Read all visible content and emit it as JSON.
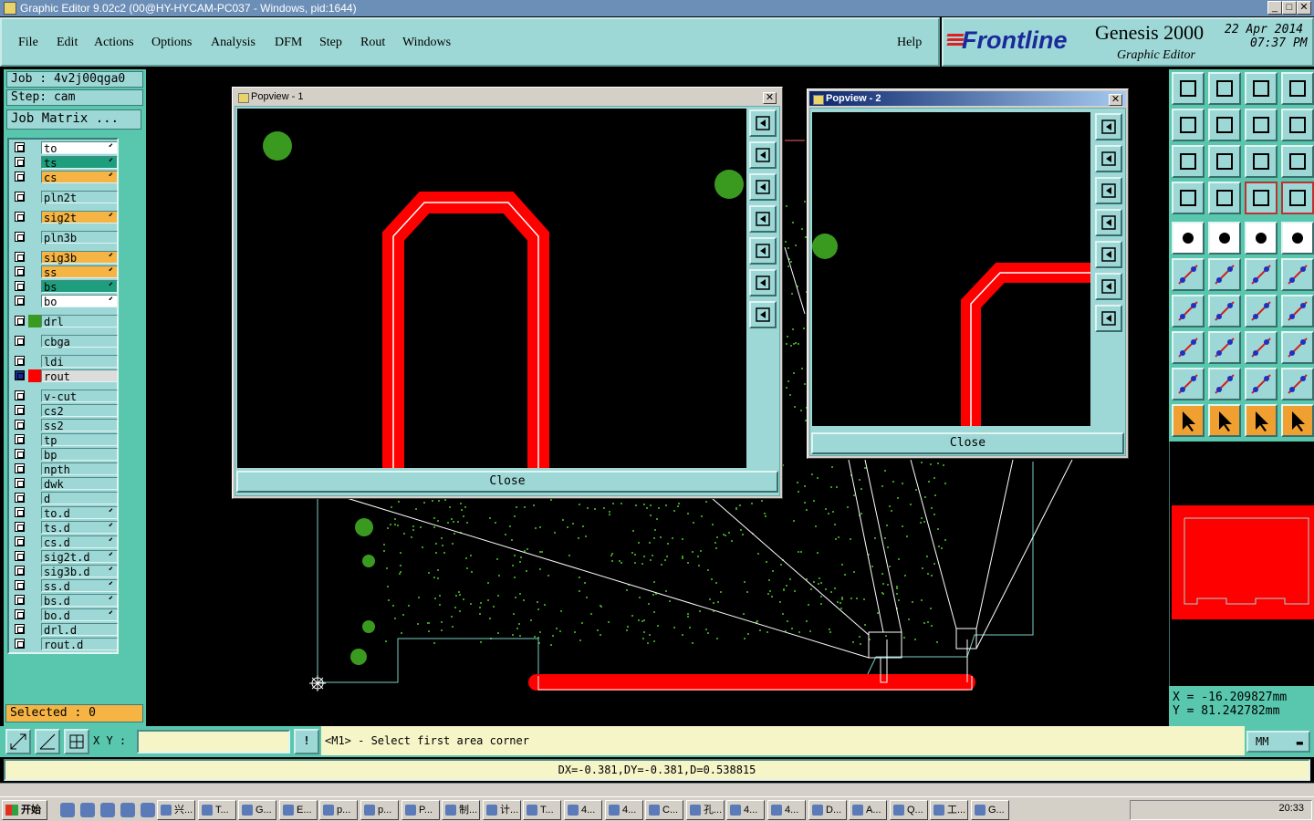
{
  "window": {
    "title": "Graphic Editor 9.02c2 (00@HY-HYCAM-PC037 - Windows, pid:1644)"
  },
  "menu": [
    "File",
    "Edit",
    "Actions",
    "Options",
    "Analysis",
    "DFM",
    "Step",
    "Rout",
    "Windows"
  ],
  "help_label": "Help",
  "logo": {
    "brand": "Frontline",
    "product": "Genesis 2000",
    "subtitle": "Graphic Editor",
    "date": "22 Apr 2014",
    "time": "07:37 PM"
  },
  "job": {
    "job_label": "Job : 4v2j00qga0",
    "step_label": "Step: cam",
    "matrix_label": "Job Matrix ..."
  },
  "layers": [
    {
      "name": "to",
      "color": "#ffffff",
      "arrow": true
    },
    {
      "name": "ts",
      "color": "#1f9e7e",
      "arrow": true
    },
    {
      "name": "cs",
      "color": "#f5b443",
      "arrow": true
    },
    {
      "name": "pln2t",
      "color": "",
      "arrow": false
    },
    {
      "name": "sig2t",
      "color": "#f5b443",
      "arrow": true
    },
    {
      "name": "pln3b",
      "color": "",
      "arrow": false
    },
    {
      "name": "sig3b",
      "color": "#f5b443",
      "arrow": true
    },
    {
      "name": "ss",
      "color": "#f5b443",
      "arrow": true
    },
    {
      "name": "bs",
      "color": "#1f9e7e",
      "arrow": true
    },
    {
      "name": "bo",
      "color": "#ffffff",
      "arrow": true
    },
    {
      "name": "drl",
      "color": "",
      "arrow": false,
      "swatch": "#3a9a20"
    },
    {
      "name": "cbga",
      "color": "",
      "arrow": false
    },
    {
      "name": "ldi",
      "color": "",
      "arrow": false
    },
    {
      "name": "rout",
      "color": "#dcdcdc",
      "arrow": false,
      "swatch": "#ff0000",
      "active": true
    },
    {
      "name": "v-cut",
      "color": "",
      "arrow": false
    },
    {
      "name": "cs2",
      "color": "",
      "arrow": false
    },
    {
      "name": "ss2",
      "color": "",
      "arrow": false
    },
    {
      "name": "tp",
      "color": "",
      "arrow": false
    },
    {
      "name": "bp",
      "color": "",
      "arrow": false
    },
    {
      "name": "npth",
      "color": "",
      "arrow": false
    },
    {
      "name": "dwk",
      "color": "",
      "arrow": false
    },
    {
      "name": "d",
      "color": "",
      "arrow": false
    },
    {
      "name": "to.d",
      "color": "",
      "arrow": true
    },
    {
      "name": "ts.d",
      "color": "",
      "arrow": true
    },
    {
      "name": "cs.d",
      "color": "",
      "arrow": true
    },
    {
      "name": "sig2t.d",
      "color": "",
      "arrow": true
    },
    {
      "name": "sig3b.d",
      "color": "",
      "arrow": true
    },
    {
      "name": "ss.d",
      "color": "",
      "arrow": true
    },
    {
      "name": "bs.d",
      "color": "",
      "arrow": true
    },
    {
      "name": "bo.d",
      "color": "",
      "arrow": true
    },
    {
      "name": "drl.d",
      "color": "",
      "arrow": false
    },
    {
      "name": "rout.d",
      "color": "",
      "arrow": false
    }
  ],
  "selected": "Selected : 0",
  "popview1": {
    "title": "Popview - 1",
    "close": "Close"
  },
  "popview2": {
    "title": "Popview - 2",
    "close": "Close"
  },
  "coords": {
    "x": "X  =  -16.209827mm",
    "y": "Y  =  81.242782mm"
  },
  "cmd": {
    "xy_label": "X Y :",
    "prompt": "<M1> - Select first area corner",
    "units": "MM"
  },
  "status": "DX=-0.381,DY=-0.381,D=0.538815",
  "taskbar": {
    "start": "开始",
    "clock": "20:33",
    "tasks": [
      "兴...",
      "T...",
      "G...",
      "E...",
      "p...",
      "p...",
      "P...",
      "制...",
      "计...",
      "T...",
      "4...",
      "4...",
      "C...",
      "孔...",
      "4...",
      "4...",
      "D...",
      "A...",
      "Q...",
      "工...",
      "G..."
    ]
  }
}
